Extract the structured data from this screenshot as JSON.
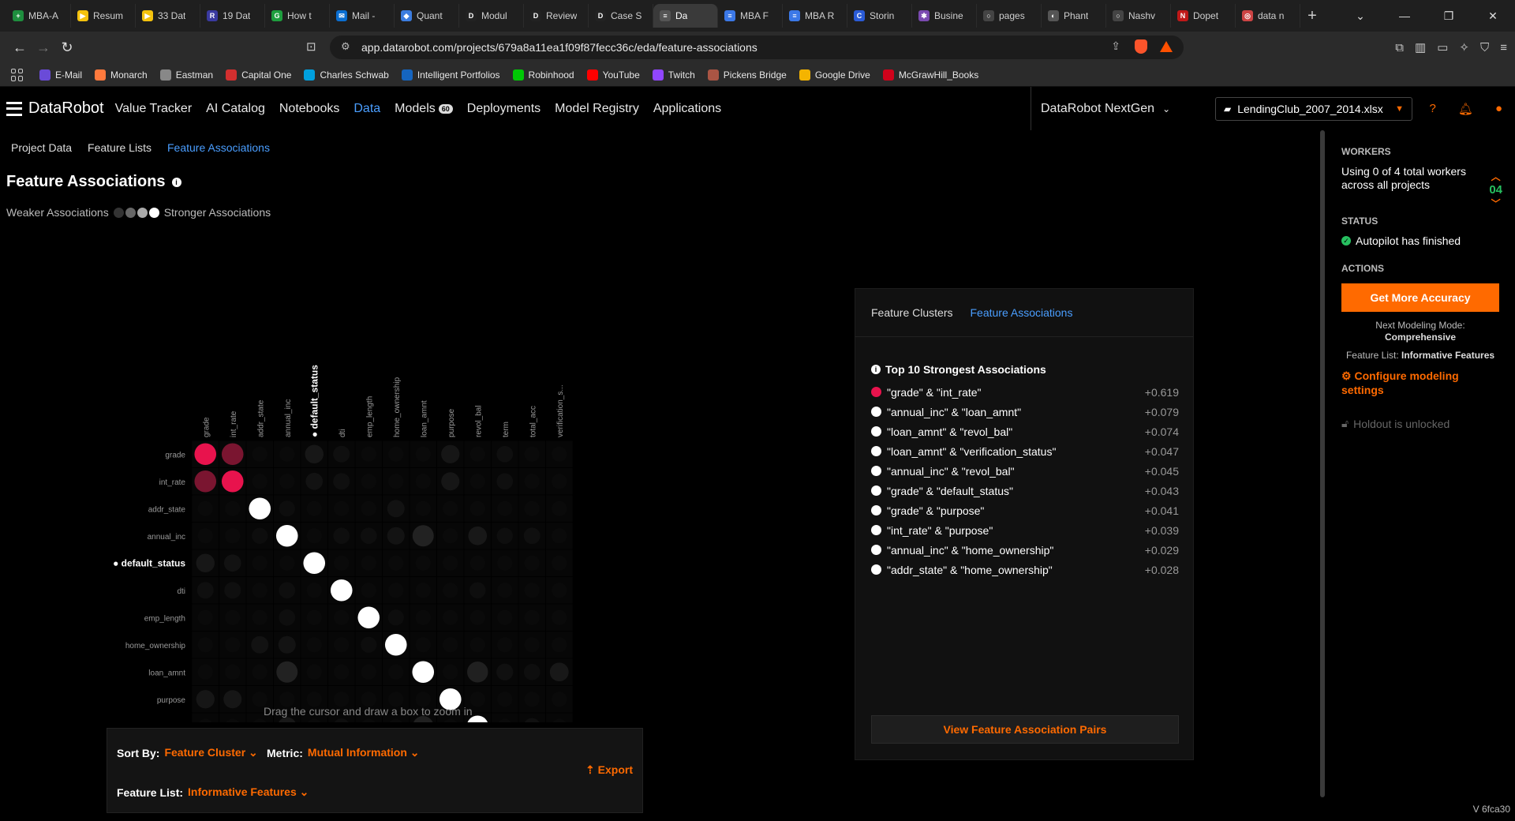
{
  "browser": {
    "tabs": [
      {
        "title": "MBA-A",
        "color": "#1e8e3e",
        "glyph": "+"
      },
      {
        "title": "Resum",
        "color": "#f4c20d",
        "glyph": "▶"
      },
      {
        "title": "33 Dat",
        "color": "#f4c20d",
        "glyph": "▶"
      },
      {
        "title": "19 Dat",
        "color": "#3a3aa0",
        "glyph": "R"
      },
      {
        "title": "How t",
        "color": "#1e9e3e",
        "glyph": "G"
      },
      {
        "title": "Mail -",
        "color": "#0a6ed1",
        "glyph": "✉"
      },
      {
        "title": "Quant",
        "color": "#3c7de0",
        "glyph": "◆"
      },
      {
        "title": "Modul",
        "color": "#222222",
        "glyph": "D"
      },
      {
        "title": "Review",
        "color": "#222222",
        "glyph": "D"
      },
      {
        "title": "Case S",
        "color": "#222222",
        "glyph": "D"
      },
      {
        "title": "Da",
        "color": "#555555",
        "glyph": "≡",
        "active": true
      },
      {
        "title": "MBA F",
        "color": "#3b78e7",
        "glyph": "≡"
      },
      {
        "title": "MBA R",
        "color": "#3b78e7",
        "glyph": "≡"
      },
      {
        "title": "Storin",
        "color": "#2a5bd7",
        "glyph": "C"
      },
      {
        "title": "Busine",
        "color": "#7a4ab0",
        "glyph": "✱"
      },
      {
        "title": "pages",
        "color": "#444444",
        "glyph": "○"
      },
      {
        "title": "Phant",
        "color": "#555555",
        "glyph": "◐"
      },
      {
        "title": "Nashv",
        "color": "#444444",
        "glyph": "○"
      },
      {
        "title": "Dopet",
        "color": "#c01818",
        "glyph": "N"
      },
      {
        "title": "data n",
        "color": "#cc4444",
        "glyph": "◎"
      }
    ],
    "url": "app.datarobot.com/projects/679a8a11ea1f09f87fecc36c/eda/feature-associations",
    "bookmarks": [
      {
        "label": "E-Mail",
        "color": "#6a4bd8"
      },
      {
        "label": "Monarch",
        "color": "#ff7a3d"
      },
      {
        "label": "Eastman",
        "color": "#888888"
      },
      {
        "label": "Capital One",
        "color": "#d32f2f"
      },
      {
        "label": "Charles Schwab",
        "color": "#00a0df"
      },
      {
        "label": "Intelligent Portfolios",
        "color": "#1565c0"
      },
      {
        "label": "Robinhood",
        "color": "#00c805"
      },
      {
        "label": "YouTube",
        "color": "#ff0000"
      },
      {
        "label": "Twitch",
        "color": "#9146ff"
      },
      {
        "label": "Pickens Bridge",
        "color": "#aa5544"
      },
      {
        "label": "Google Drive",
        "color": "#f4b400"
      },
      {
        "label": "McGrawHill_Books",
        "color": "#d0021b"
      }
    ]
  },
  "app": {
    "brand": "DataRobot",
    "nav": [
      {
        "label": "Value Tracker"
      },
      {
        "label": "AI Catalog"
      },
      {
        "label": "Notebooks"
      },
      {
        "label": "Data",
        "active": true
      },
      {
        "label": "Models",
        "badge": "60"
      },
      {
        "label": "Deployments"
      },
      {
        "label": "Model Registry"
      },
      {
        "label": "Applications"
      }
    ],
    "workspace": "DataRobot NextGen",
    "file": "LendingClub_2007_2014.xlsx"
  },
  "subnav": [
    "Project Data",
    "Feature Lists",
    "Feature Associations"
  ],
  "page": {
    "title": "Feature Associations",
    "legend_weak": "Weaker Associations",
    "legend_strong": "Stronger Associations",
    "zoom_hint": "Drag the cursor and draw a box to zoom in",
    "sort_by_label": "Sort By:",
    "sort_by_value": "Feature Cluster",
    "metric_label": "Metric:",
    "metric_value": "Mutual Information",
    "feature_list_label": "Feature List:",
    "feature_list_value": "Informative Features",
    "export_label": "Export"
  },
  "chart_data": {
    "type": "heatmap",
    "features": [
      "grade",
      "int_rate",
      "addr_state",
      "annual_inc",
      "default_status",
      "dti",
      "emp_length",
      "home_ownership",
      "loan_amnt",
      "purpose",
      "revol_bal",
      "term",
      "total_acc",
      "verification_s..."
    ],
    "highlighted_feature": "default_status",
    "cluster_features": [
      "grade",
      "int_rate"
    ],
    "off_diagonal": [
      {
        "a": "grade",
        "b": "int_rate",
        "value": 0.619
      },
      {
        "a": "annual_inc",
        "b": "loan_amnt",
        "value": 0.079
      },
      {
        "a": "loan_amnt",
        "b": "revol_bal",
        "value": 0.074
      },
      {
        "a": "loan_amnt",
        "b": "verification_s...",
        "value": 0.047
      },
      {
        "a": "annual_inc",
        "b": "revol_bal",
        "value": 0.045
      },
      {
        "a": "grade",
        "b": "default_status",
        "value": 0.043
      },
      {
        "a": "grade",
        "b": "purpose",
        "value": 0.041
      },
      {
        "a": "int_rate",
        "b": "purpose",
        "value": 0.039
      },
      {
        "a": "annual_inc",
        "b": "home_ownership",
        "value": 0.029
      },
      {
        "a": "addr_state",
        "b": "home_ownership",
        "value": 0.028
      },
      {
        "a": "int_rate",
        "b": "default_status",
        "value": 0.025
      },
      {
        "a": "grade",
        "b": "dti",
        "value": 0.018
      },
      {
        "a": "int_rate",
        "b": "dti",
        "value": 0.018
      },
      {
        "a": "annual_inc",
        "b": "dti",
        "value": 0.014
      },
      {
        "a": "annual_inc",
        "b": "emp_length",
        "value": 0.014
      },
      {
        "a": "annual_inc",
        "b": "total_acc",
        "value": 0.016
      },
      {
        "a": "annual_inc",
        "b": "term",
        "value": 0.012
      },
      {
        "a": "loan_amnt",
        "b": "term",
        "value": 0.02
      },
      {
        "a": "loan_amnt",
        "b": "total_acc",
        "value": 0.014
      },
      {
        "a": "revol_bal",
        "b": "total_acc",
        "value": 0.02
      },
      {
        "a": "revol_bal",
        "b": "dti",
        "value": 0.012
      },
      {
        "a": "grade",
        "b": "term",
        "value": 0.015
      },
      {
        "a": "int_rate",
        "b": "term",
        "value": 0.015
      },
      {
        "a": "addr_state",
        "b": "annual_inc",
        "value": 0.01
      },
      {
        "a": "emp_length",
        "b": "home_ownership",
        "value": 0.01
      }
    ],
    "weak_color": "#141414",
    "strong_color": "#ffffff",
    "cluster_colors": [
      "#7a1530",
      "#b3153f",
      "#e8134d"
    ]
  },
  "assoc_panel": {
    "tabs": [
      "Feature Clusters",
      "Feature Associations"
    ],
    "heading": "Top 10 Strongest Associations",
    "rows": [
      {
        "pair": "\"grade\" & \"int_rate\"",
        "value": "+0.619",
        "color": "#e8134d"
      },
      {
        "pair": "\"annual_inc\" & \"loan_amnt\"",
        "value": "+0.079",
        "color": "#ffffff"
      },
      {
        "pair": "\"loan_amnt\" & \"revol_bal\"",
        "value": "+0.074",
        "color": "#ffffff"
      },
      {
        "pair": "\"loan_amnt\" & \"verification_status\"",
        "value": "+0.047",
        "color": "#ffffff"
      },
      {
        "pair": "\"annual_inc\" & \"revol_bal\"",
        "value": "+0.045",
        "color": "#ffffff"
      },
      {
        "pair": "\"grade\" & \"default_status\"",
        "value": "+0.043",
        "color": "#ffffff"
      },
      {
        "pair": "\"grade\" & \"purpose\"",
        "value": "+0.041",
        "color": "#ffffff"
      },
      {
        "pair": "\"int_rate\" & \"purpose\"",
        "value": "+0.039",
        "color": "#ffffff"
      },
      {
        "pair": "\"annual_inc\" & \"home_ownership\"",
        "value": "+0.029",
        "color": "#ffffff"
      },
      {
        "pair": "\"addr_state\" & \"home_ownership\"",
        "value": "+0.028",
        "color": "#ffffff"
      }
    ],
    "button": "View Feature Association Pairs"
  },
  "sidebar": {
    "workers_label": "WORKERS",
    "workers_text": "Using 0 of 4 total workers across all projects",
    "workers_count": "04",
    "status_label": "STATUS",
    "status_text": "Autopilot has finished",
    "actions_label": "ACTIONS",
    "accuracy_button": "Get More Accuracy",
    "next_mode_label": "Next Modeling Mode:",
    "next_mode_value": "Comprehensive",
    "feature_list_label": "Feature List:",
    "feature_list_value": "Informative Features",
    "configure_label": "Configure modeling settings",
    "holdout_text": "Holdout is unlocked",
    "version": "V 6fca30"
  }
}
